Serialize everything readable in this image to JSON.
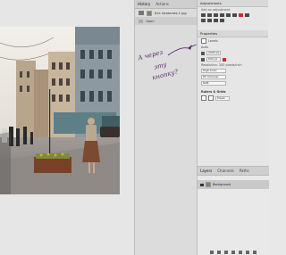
{
  "history_panel": {
    "tabs": [
      "History",
      "Actions"
    ],
    "rows": [
      {
        "label": "Без названия-1.jpg"
      },
      {
        "label": "Open"
      }
    ]
  },
  "adjustments": {
    "title": "Adjustments",
    "subtitle": "Add an adjustment"
  },
  "properties": {
    "title": "Properties",
    "preset_label": "Levels",
    "fields": [
      {
        "label": "Auto",
        "value": ""
      },
      {
        "label": "",
        "value": "2000 px"
      },
      {
        "label": "",
        "value": "600 px"
      }
    ],
    "resolution_label": "Resolution: 300 pixels/inch",
    "dropdowns": [
      "High Color",
      "Fill Channel",
      "RGB"
    ],
    "section2": "Rulers & Grids",
    "pixels_label": "Pixels"
  },
  "layers": {
    "tabs": [
      "Layers",
      "Channels",
      "Paths"
    ],
    "layer_name": "Background"
  },
  "annotation": {
    "line1": "А через",
    "line2": "эту",
    "line3": "кнопку?"
  },
  "colors": {
    "accent": "#d9262c",
    "annotation": "#5a2c6e"
  }
}
